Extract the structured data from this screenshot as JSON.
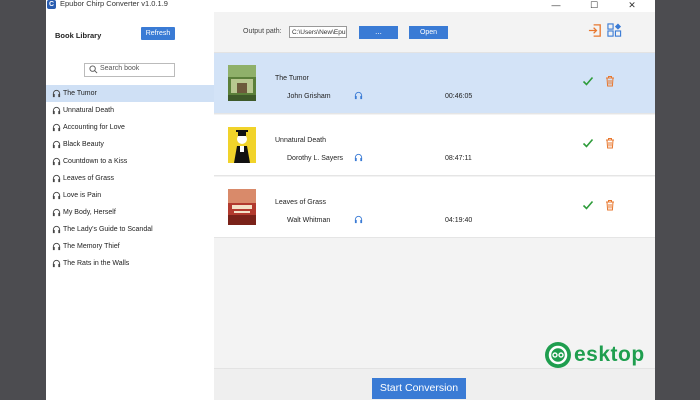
{
  "window": {
    "title": "Epubor Chirp Converter v1.0.1.9",
    "controls": {
      "minimize": "—",
      "maximize": "☐",
      "close": "✕"
    }
  },
  "sidebar": {
    "title": "Book Library",
    "refresh_label": "Refresh",
    "search_placeholder": "Search book",
    "items": [
      {
        "label": "The Tumor",
        "selected": true
      },
      {
        "label": "Unnatural Death",
        "selected": false
      },
      {
        "label": "Accounting for Love",
        "selected": false
      },
      {
        "label": "Black Beauty",
        "selected": false
      },
      {
        "label": "Countdown to a Kiss",
        "selected": false
      },
      {
        "label": "Leaves of Grass",
        "selected": false
      },
      {
        "label": "Love is Pain",
        "selected": false
      },
      {
        "label": "My Body, Herself",
        "selected": false
      },
      {
        "label": "The Lady's Guide to Scandal",
        "selected": false
      },
      {
        "label": "The Memory Thief",
        "selected": false
      },
      {
        "label": "The Rats in the Walls",
        "selected": false
      }
    ]
  },
  "toolbar": {
    "output_label": "Output path:",
    "output_path": "C:\\Users\\New\\Epub",
    "browse_label": "...",
    "open_label": "Open",
    "export_icon": "exit-icon",
    "apps_icon": "apps-icon"
  },
  "books": [
    {
      "title": "The Tumor",
      "author": "John Grisham",
      "duration": "00:46:05",
      "selected": true
    },
    {
      "title": "Unnatural Death",
      "author": "Dorothy L. Sayers",
      "duration": "08:47:11",
      "selected": false
    },
    {
      "title": "Leaves of Grass",
      "author": "Walt Whitman",
      "duration": "04:19:40",
      "selected": false
    }
  ],
  "bottom": {
    "start_label": "Start Conversion"
  },
  "watermark": {
    "text": "esktop"
  },
  "colors": {
    "accent": "#3a7bd5",
    "selected": "#cfe0f5",
    "check": "#2e9c3a",
    "trash": "#e8772e",
    "frame": "#4c4c50"
  }
}
